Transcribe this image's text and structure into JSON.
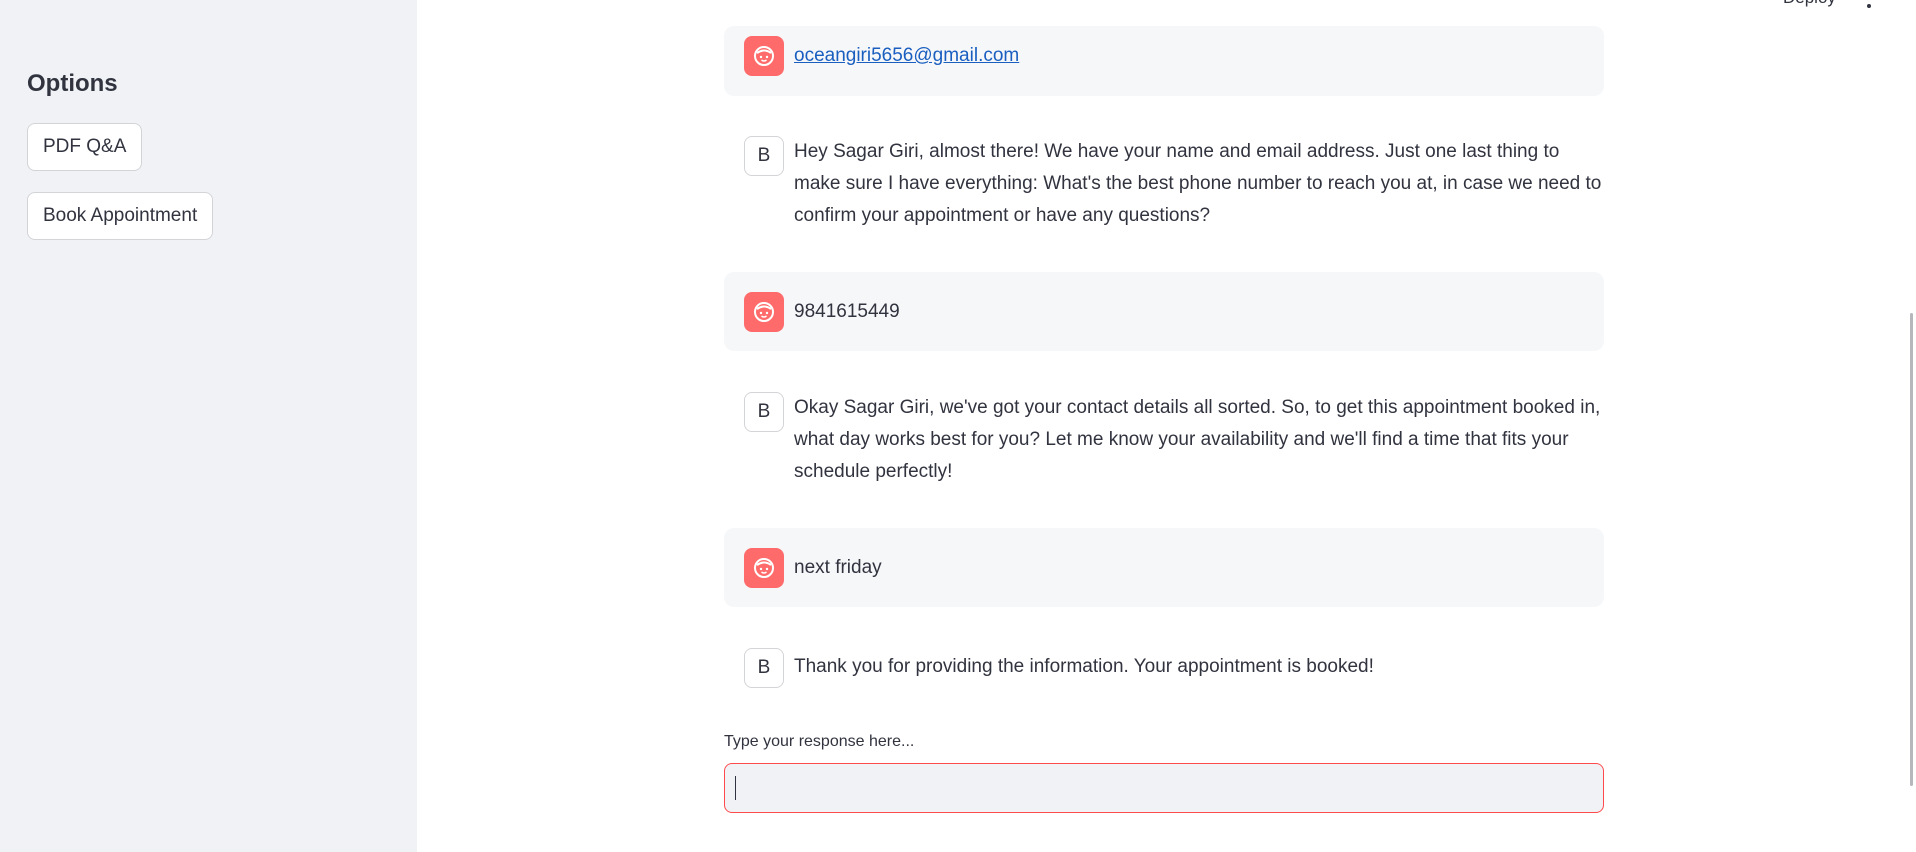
{
  "header": {
    "deploy_label": "Deploy"
  },
  "sidebar": {
    "title": "Options",
    "buttons": [
      {
        "label": "PDF Q&A"
      },
      {
        "label": "Book Appointment"
      }
    ]
  },
  "chat": {
    "bot_avatar_letter": "B",
    "messages": [
      {
        "role": "user",
        "text": "oceangiri5656@gmail.com"
      },
      {
        "role": "bot",
        "text": "Hey Sagar Giri, almost there! We have your name and email address. Just one last thing to make sure I have everything: What's the best phone number to reach you at, in case we need to confirm your appointment or have any questions?"
      },
      {
        "role": "user",
        "text": "9841615449"
      },
      {
        "role": "bot",
        "text": "Okay Sagar Giri, we've got your contact details all sorted. So, to get this appointment booked in, what day works best for you? Let me know your availability and we'll find a time that fits your schedule perfectly!"
      },
      {
        "role": "user",
        "text": "next friday"
      },
      {
        "role": "bot",
        "text": "Thank you for providing the information. Your appointment is booked!"
      }
    ]
  },
  "input": {
    "label": "Type your response here...",
    "value": ""
  },
  "colors": {
    "accent": "#ff4b4b",
    "user_avatar": "#ff6b6b",
    "sidebar_bg": "#f0f2f6",
    "link": "#1a5fc0"
  }
}
